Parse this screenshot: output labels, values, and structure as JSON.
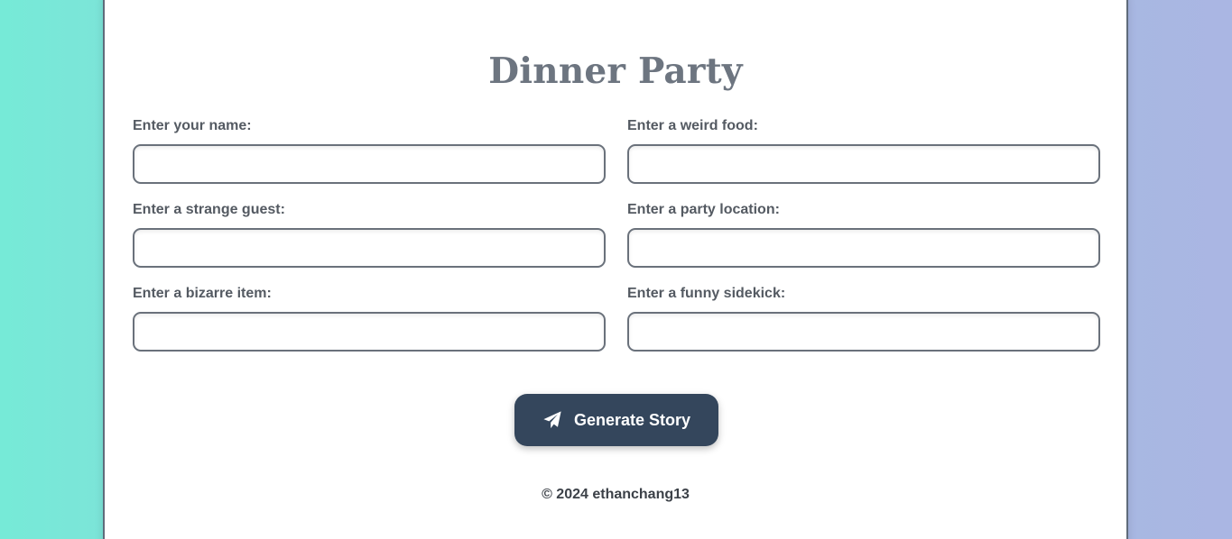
{
  "page": {
    "title": "Dinner Party"
  },
  "form": {
    "fields": [
      {
        "label": "Enter your name:",
        "value": "",
        "placeholder": ""
      },
      {
        "label": "Enter a weird food:",
        "value": "",
        "placeholder": ""
      },
      {
        "label": "Enter a strange guest:",
        "value": "",
        "placeholder": ""
      },
      {
        "label": "Enter a party location:",
        "value": "",
        "placeholder": ""
      },
      {
        "label": "Enter a bizarre item:",
        "value": "",
        "placeholder": ""
      },
      {
        "label": "Enter a funny sidekick:",
        "value": "",
        "placeholder": ""
      }
    ],
    "submit": {
      "label": "Generate Story",
      "icon": "paper-plane-icon"
    }
  },
  "footer": {
    "text": "© 2024 ethanchang13"
  },
  "colors": {
    "button_bg": "#34465c",
    "title": "#6d7580",
    "background_left": "#76ead7",
    "background_right": "#aab6e3"
  }
}
